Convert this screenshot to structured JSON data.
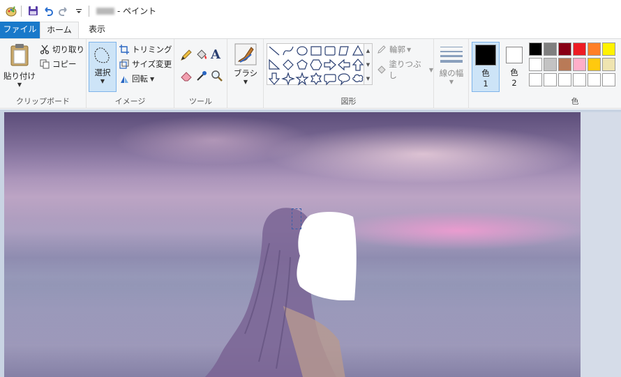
{
  "title": {
    "app_name_blurred": "",
    "app_suffix": "- ペイント"
  },
  "tabs": [
    {
      "label": "ファイル"
    },
    {
      "label": "ホーム"
    },
    {
      "label": "表示"
    }
  ],
  "clipboard": {
    "paste": "貼り付け",
    "cut": "切り取り",
    "copy": "コピー",
    "label": "クリップボード"
  },
  "image": {
    "select": "選択",
    "crop": "トリミング",
    "resize": "サイズ変更",
    "rotate": "回転",
    "label": "イメージ"
  },
  "tools": {
    "label": "ツール"
  },
  "brushes": {
    "label": "ブラシ"
  },
  "shapes": {
    "outline": "輪郭",
    "fill": "塗りつぶし",
    "label": "図形"
  },
  "size": {
    "label": "線の幅"
  },
  "colors": {
    "color1_label": "色",
    "color1_num": "1",
    "color2_label": "色",
    "color2_num": "2",
    "label": "色",
    "color1_value": "#000000",
    "color2_value": "#ffffff",
    "palette_row1": [
      "#000000",
      "#7f7f7f",
      "#880015",
      "#ed1c24",
      "#ff7f27",
      "#fff200"
    ],
    "palette_row2": [
      "#ffffff",
      "#c3c3c3",
      "#b97a57",
      "#ffaec9",
      "#ffc90e",
      "#efe4b0"
    ],
    "palette_row3": [
      "",
      "",
      "",
      "",
      "",
      ""
    ]
  }
}
